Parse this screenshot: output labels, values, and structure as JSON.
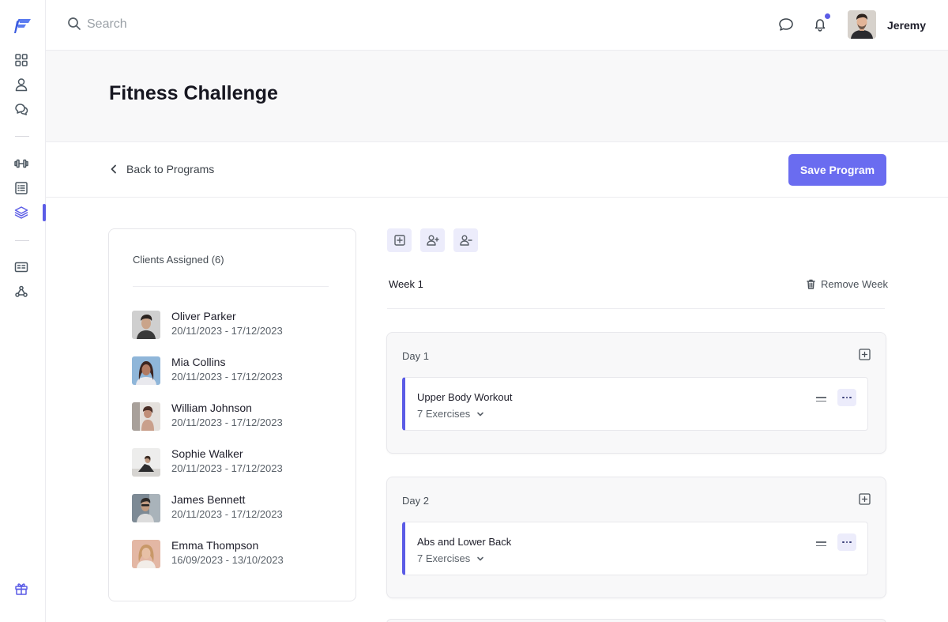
{
  "app": {
    "accent_color": "#5b5ce6",
    "button_color": "#6a6cf0"
  },
  "sidebar": {
    "logo": "brand-logo",
    "items": [
      {
        "icon": "dashboard-icon",
        "active": false
      },
      {
        "icon": "user-icon",
        "active": false
      },
      {
        "icon": "chat-bubbles-icon",
        "active": false
      },
      {
        "icon": "dumbbell-icon",
        "active": false
      },
      {
        "icon": "list-icon",
        "active": false
      },
      {
        "icon": "layers-icon",
        "active": true
      },
      {
        "icon": "id-card-icon",
        "active": false
      },
      {
        "icon": "webhook-icon",
        "active": false
      }
    ],
    "footer_icon": "gift-icon"
  },
  "topbar": {
    "search_placeholder": "Search",
    "message_icon": "message-icon",
    "notification_icon": "bell-icon",
    "user_name": "Jeremy"
  },
  "header": {
    "title": "Fitness Challenge"
  },
  "actions": {
    "back_label": "Back to Programs",
    "save_label": "Save Program"
  },
  "clients": {
    "title": "Clients Assigned (6)",
    "list": [
      {
        "name": "Oliver Parker",
        "dates": "20/11/2023 - 17/12/2023"
      },
      {
        "name": "Mia Collins",
        "dates": "20/11/2023 - 17/12/2023"
      },
      {
        "name": "William Johnson",
        "dates": "20/11/2023 - 17/12/2023"
      },
      {
        "name": "Sophie Walker",
        "dates": "20/11/2023 - 17/12/2023"
      },
      {
        "name": "James Bennett",
        "dates": "20/11/2023 - 17/12/2023"
      },
      {
        "name": "Emma Thompson",
        "dates": "16/09/2023 - 13/10/2023"
      }
    ]
  },
  "program": {
    "tools": [
      "add-day-icon",
      "add-client-icon",
      "remove-client-icon"
    ],
    "week_label": "Week 1",
    "remove_week_label": "Remove Week",
    "days": [
      {
        "label": "Day 1",
        "workout": {
          "name": "Upper Body Workout",
          "exercises": "7 Exercises"
        }
      },
      {
        "label": "Day 2",
        "workout": {
          "name": "Abs and Lower Back",
          "exercises": "7 Exercises"
        }
      }
    ]
  }
}
